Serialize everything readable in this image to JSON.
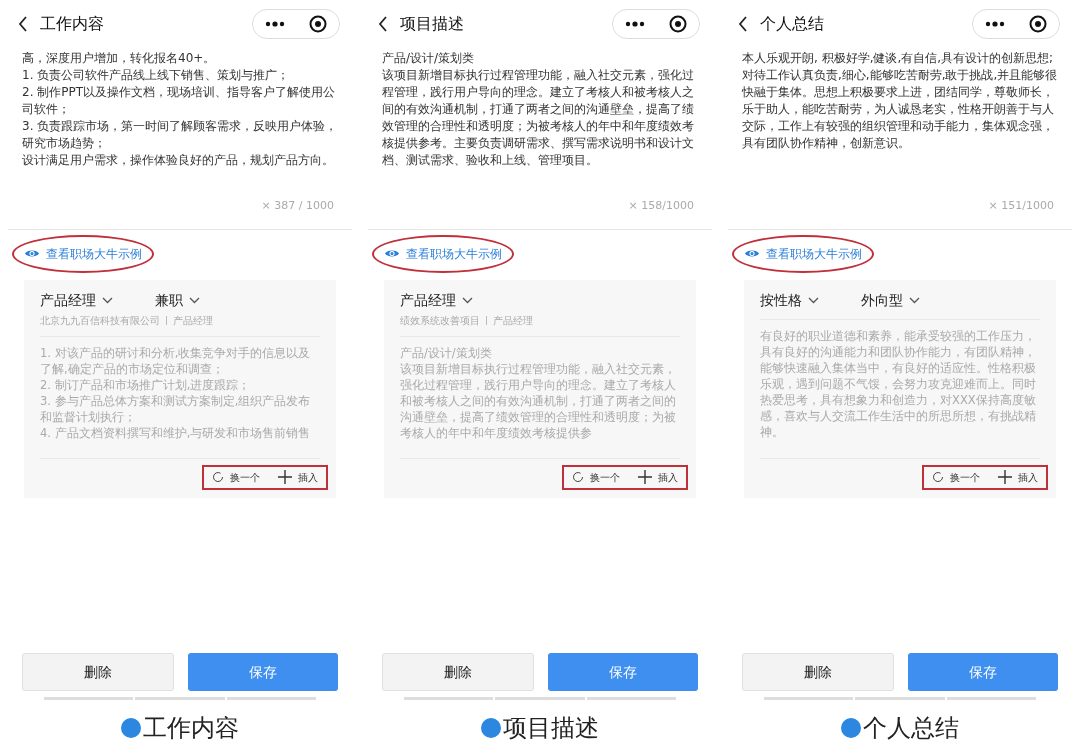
{
  "panels": [
    {
      "title": "工作内容",
      "text": [
        "高，深度用户增加，转化报名40+。",
        "1. 负责公司软件产品线上线下销售、策划与推广；",
        "2. 制作PPT以及操作文档，现场培训、指导客户了解使用公司软件；",
        "3. 负责跟踪市场，第一时间了解顾客需求，反映用户体验，研究市场趋势；",
        "设计满足用户需求，操作体验良好的产品，规划产品方向。"
      ],
      "counter": "× 387 / 1000",
      "example_link": "查看职场大牛示例",
      "example": {
        "selectors": [
          "产品经理",
          "兼职"
        ],
        "subtitle": [
          "北京九九百信科技有限公司",
          "产品经理"
        ],
        "body": [
          "1. 对该产品的研讨和分析,收集竞争对手的信息以及了解,确定产品的市场定位和调查；",
          "2. 制订产品和市场推广计划,进度跟踪；",
          "3. 参与产品总体方案和测试方案制定,组织产品发布和监督计划执行；",
          "4. 产品文档资料撰写和维护,与研发和市场售前销售"
        ],
        "swap": "换一个",
        "insert": "插入"
      },
      "buttons": [
        "删除",
        "保存"
      ],
      "caption": "工作内容"
    },
    {
      "title": "项目描述",
      "text": [
        "产品/设计/策划类",
        "该项目新增目标执行过程管理功能，融入社交元素，强化过程管理，践行用户导向的理念。建立了考核人和被考核人之间的有效沟通机制，打通了两者之间的沟通壁垒，提高了绩效管理的合理性和透明度；为被考核人的年中和年度绩效考核提供参考。主要负责调研需求、撰写需求说明书和设计文档、测试需求、验收和上线、管理项目。"
      ],
      "counter": "× 158/1000",
      "example_link": "查看职场大牛示例",
      "example": {
        "selectors": [
          "产品经理"
        ],
        "subtitle": [
          "绩效系统改善项目",
          "产品经理"
        ],
        "body": [
          "产品/设计/策划类",
          "该项目新增目标执行过程管理功能，融入社交元素，强化过程管理，践行用户导向的理念。建立了考核人和被考核人之间的有效沟通机制，打通了两者之间的沟通壁垒，提高了绩效管理的合理性和透明度；为被考核人的年中和年度绩效考核提供参"
        ],
        "swap": "换一个",
        "insert": "插入"
      },
      "buttons": [
        "删除",
        "保存"
      ],
      "caption": "项目描述"
    },
    {
      "title": "个人总结",
      "text": [
        "本人乐观开朗, 积极好学,健谈,有自信,具有设计的创新思想;对待工作认真负责,细心,能够吃苦耐劳,敢于挑战,并且能够很快融于集体。思想上积极要求上进，团结同学，尊敬师长，乐于助人，能吃苦耐劳，为人诚恳老实，性格开朗善于与人交际，工作上有较强的组织管理和动手能力，集体观念强，具有团队协作精神，创新意识。"
      ],
      "counter": "× 151/1000",
      "example_link": "查看职场大牛示例",
      "example": {
        "selectors": [
          "按性格",
          "外向型"
        ],
        "body": [
          "有良好的职业道德和素养，能承受较强的工作压力，具有良好的沟通能力和团队协作能力，有团队精神，能够快速融入集体当中，有良好的适应性。性格积极乐观，遇到问题不气馁，会努力攻克迎难而上。同时热爱思考，具有想象力和创造力，对XXX保持高度敏感，喜欢与人交流工作生活中的所思所想，有挑战精神。"
        ],
        "swap": "换一个",
        "insert": "插入"
      },
      "buttons": [
        "删除",
        "保存"
      ],
      "caption": "个人总结"
    }
  ]
}
